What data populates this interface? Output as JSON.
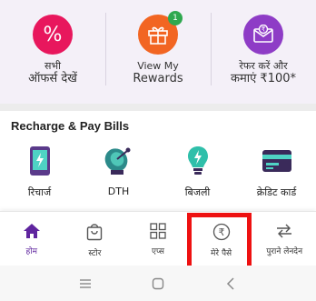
{
  "promos": [
    {
      "line1": "सभी",
      "line2": "ऑफर्स देखें",
      "icon": "percent-icon",
      "color": "#e8175d"
    },
    {
      "line1": "View My",
      "line2": "Rewards",
      "icon": "gift-icon",
      "color": "#f26522",
      "badge": "1"
    },
    {
      "line1": "रेफर करें और",
      "line2": "कमाएं ₹100*",
      "icon": "refer-envelope-icon",
      "color": "#8e3cc6"
    }
  ],
  "recharge": {
    "title": "Recharge & Pay Bills",
    "items": [
      {
        "label": "रिचार्ज",
        "icon": "mobile-recharge-icon"
      },
      {
        "label": "DTH",
        "icon": "satellite-dish-icon"
      },
      {
        "label": "बिजली",
        "icon": "bulb-icon"
      },
      {
        "label": "क्रेडिट कार्ड",
        "icon": "credit-card-icon"
      }
    ]
  },
  "nav": {
    "items": [
      {
        "label": "होम",
        "icon": "home-icon"
      },
      {
        "label": "स्टोर",
        "icon": "store-bag-icon"
      },
      {
        "label": "एप्स",
        "icon": "apps-grid-icon"
      },
      {
        "label": "मेरे पैसे",
        "icon": "rupee-circle-icon"
      },
      {
        "label": "पुराने लेनदेन",
        "icon": "transactions-arrows-icon"
      }
    ],
    "active_index": 0,
    "highlighted_index": 3
  },
  "colors": {
    "brand": "#5f259f",
    "highlight": "#ee1111",
    "accent_green": "#2fa84f"
  }
}
